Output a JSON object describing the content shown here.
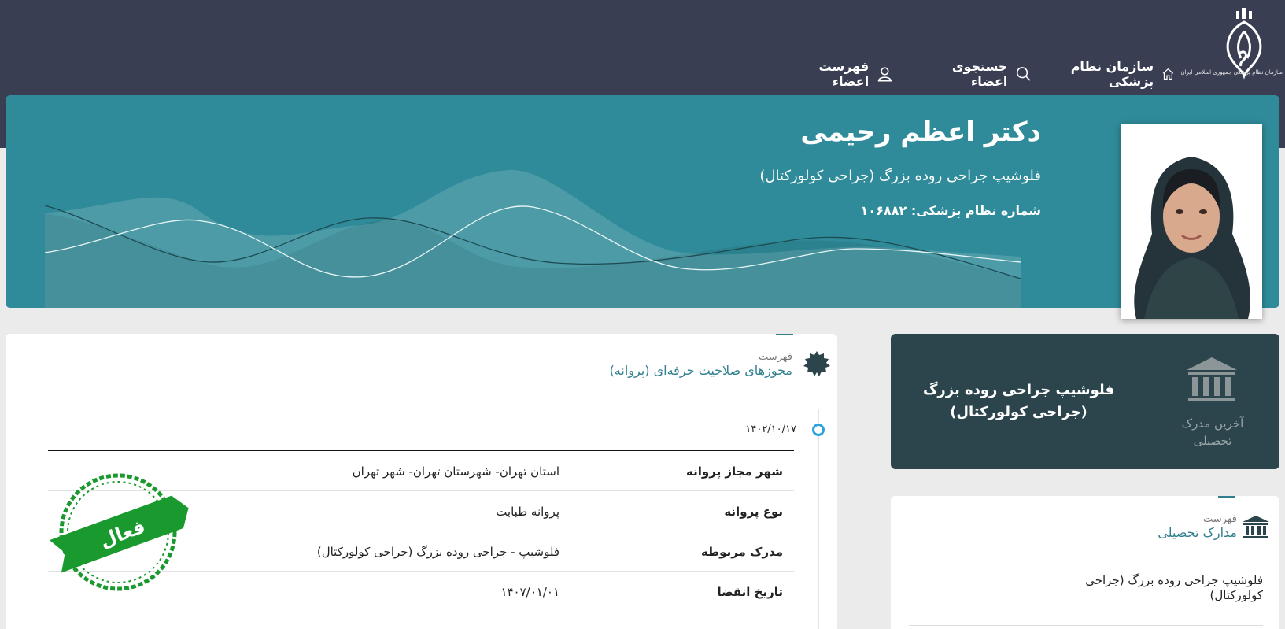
{
  "header": {
    "logo_caption": "سازمان نظام پزشکی جمهوری اسلامی ایران",
    "nav": [
      {
        "label": "سازمان نظام پزشکی",
        "icon": "home-icon"
      },
      {
        "label": "جستجوی اعضاء",
        "icon": "search-icon"
      },
      {
        "label": "فهرست اعضاء",
        "icon": "user-icon"
      }
    ]
  },
  "profile": {
    "name": "دکتر اعظم رحیمی",
    "specialty": "فلوشیپ جراحی روده بزرگ (جراحی کولورکتال)",
    "medical_number": "شماره نظام پزشکی: ۱۰۶۸۸۲"
  },
  "licenses": {
    "sub": "فهرست",
    "title": "مجوزهای صلاحیت حرفه‌ای (پروانه)",
    "date": "۱۴۰۲/۱۰/۱۷",
    "rows": [
      {
        "key": "شهر مجاز پروانه",
        "value": "استان تهران- شهرستان تهران- شهر تهران"
      },
      {
        "key": "نوع پروانه",
        "value": "پروانه طبابت"
      },
      {
        "key": "مدرک مربوطه",
        "value": "فلوشیپ - جراحی روده بزرگ (جراحی کولورکتال)"
      },
      {
        "key": "تاریخ انقضا",
        "value": "۱۴۰۷/۰۱/۰۱"
      }
    ],
    "status_stamp": "فعال"
  },
  "last_degree": {
    "title": "فلوشیپ جراحی روده بزرگ (جراحی کولورکتال)",
    "label": "آخرین مدرک تحصیلی"
  },
  "education": {
    "sub": "فهرست",
    "title": "مدارک تحصیلی",
    "item": "فلوشیپ جراحی روده بزرگ (جراحی کولورکتال)"
  },
  "colors": {
    "topbar": "#393e52",
    "hero": "#2f8b99",
    "accent": "#2f7f8e",
    "degree_card": "#2c454d",
    "stamp": "#1a9a2e"
  }
}
